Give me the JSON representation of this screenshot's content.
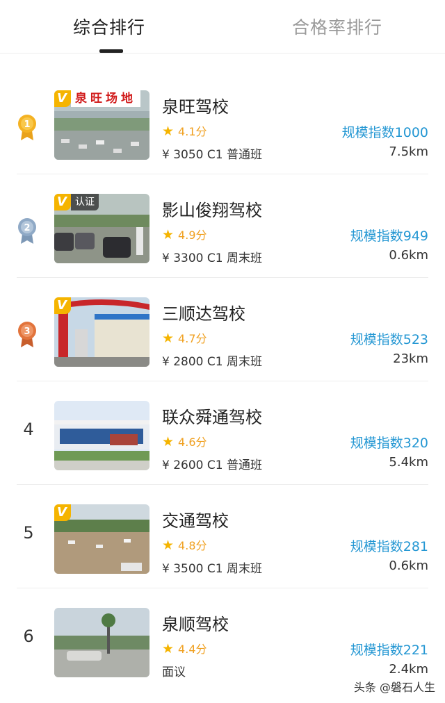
{
  "tabs": [
    {
      "label": "综合排行",
      "active": true
    },
    {
      "label": "合格率排行",
      "active": false
    }
  ],
  "colors": {
    "accent_blue": "#2497d3",
    "star": "#f5b400",
    "gold": "#f4b223",
    "silver": "#8fa9c6",
    "bronze": "#e2743c",
    "v_badge": "#f5b400"
  },
  "items": [
    {
      "rank": "1",
      "medal": "gold-medal-icon",
      "name": "泉旺驾校",
      "rating": "4.1分",
      "price": "¥ 3050 C1 普通班",
      "scale": "规模指数1000",
      "distance": "7.5km",
      "thumb_sign": "泉旺场地",
      "verified": true
    },
    {
      "rank": "2",
      "medal": "silver-medal-icon",
      "name": "影山俊翔驾校",
      "rating": "4.9分",
      "price": "¥ 3300 C1 周末班",
      "scale": "规模指数949",
      "distance": "0.6km",
      "thumb_tag": "认证",
      "verified": true
    },
    {
      "rank": "3",
      "medal": "bronze-medal-icon",
      "name": "三顺达驾校",
      "rating": "4.7分",
      "price": "¥ 2800 C1 周末班",
      "scale": "规模指数523",
      "distance": "23km",
      "verified": true
    },
    {
      "rank": "4",
      "name": "联众舜通驾校",
      "rating": "4.6分",
      "price": "¥ 2600 C1 普通班",
      "scale": "规模指数320",
      "distance": "5.4km",
      "verified": false
    },
    {
      "rank": "5",
      "name": "交通驾校",
      "rating": "4.8分",
      "price": "¥ 3500 C1 周末班",
      "scale": "规模指数281",
      "distance": "0.6km",
      "verified": true
    },
    {
      "rank": "6",
      "name": "泉顺驾校",
      "rating": "4.4分",
      "price": "面议",
      "scale": "规模指数221",
      "distance": "2.4km",
      "verified": false
    }
  ],
  "watermark": "头条 @磐石人生"
}
